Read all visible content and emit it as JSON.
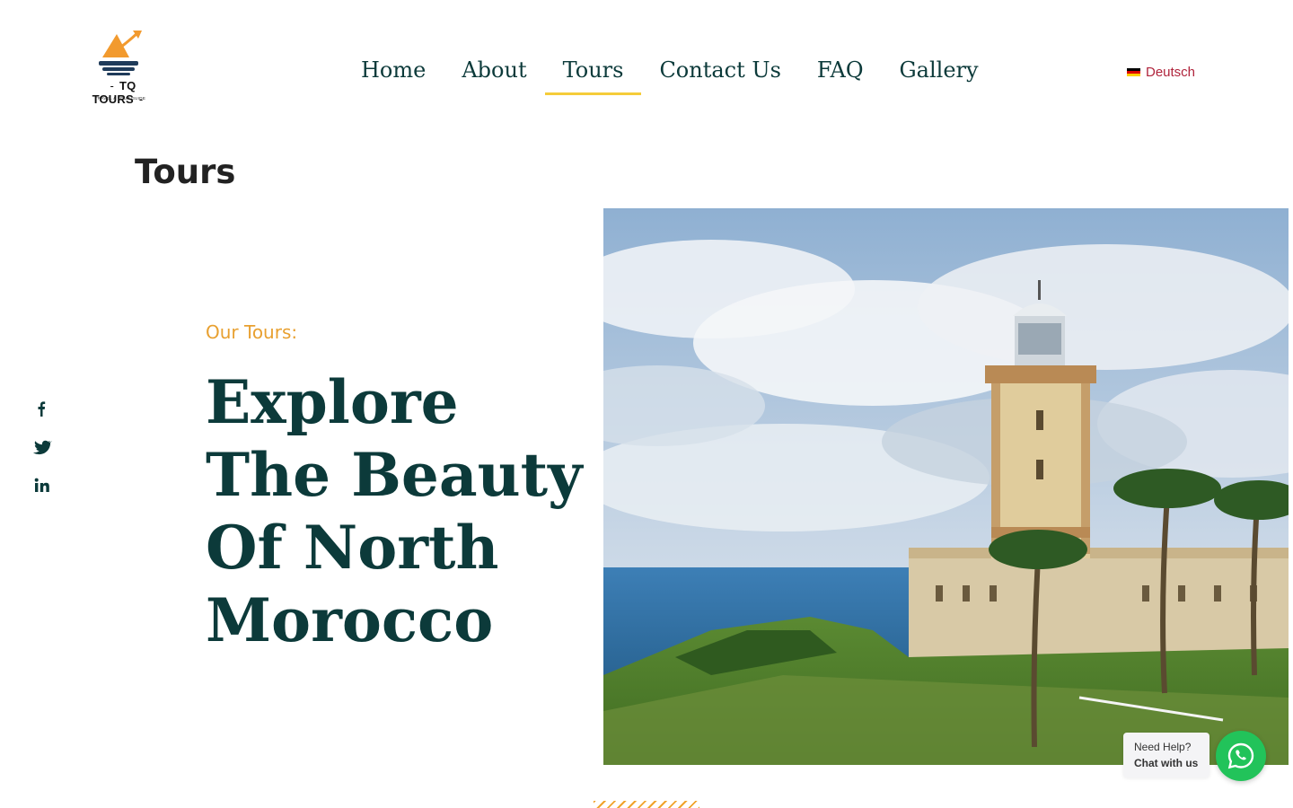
{
  "header": {
    "brand_name": "TQ TOURS",
    "brand_tagline": "TRAVEL & TOUR GUIDE",
    "nav": [
      {
        "label": "Home",
        "active": false
      },
      {
        "label": "About",
        "active": false
      },
      {
        "label": "Tours",
        "active": true
      },
      {
        "label": "Contact Us",
        "active": false
      },
      {
        "label": "FAQ",
        "active": false
      },
      {
        "label": "Gallery",
        "active": false
      }
    ],
    "language": {
      "label": "Deutsch",
      "flag_icon": "germany-flag-icon"
    }
  },
  "page_title": "Tours",
  "social": [
    {
      "icon": "facebook-icon"
    },
    {
      "icon": "twitter-icon"
    },
    {
      "icon": "linkedin-icon"
    }
  ],
  "hero": {
    "eyebrow": "Our Tours:",
    "headline_lines": [
      "Explore",
      "The Beauty",
      "Of North",
      "Morocco"
    ]
  },
  "help_widget": {
    "line1": "Need Help?",
    "line2": "Chat with us",
    "icon": "whatsapp-icon"
  },
  "colors": {
    "heading": "#0c3a3a",
    "accent_yellow": "#f5cc3a",
    "accent_orange": "#e8a030",
    "language_link": "#b0243c",
    "whatsapp_green": "#22c35a"
  }
}
